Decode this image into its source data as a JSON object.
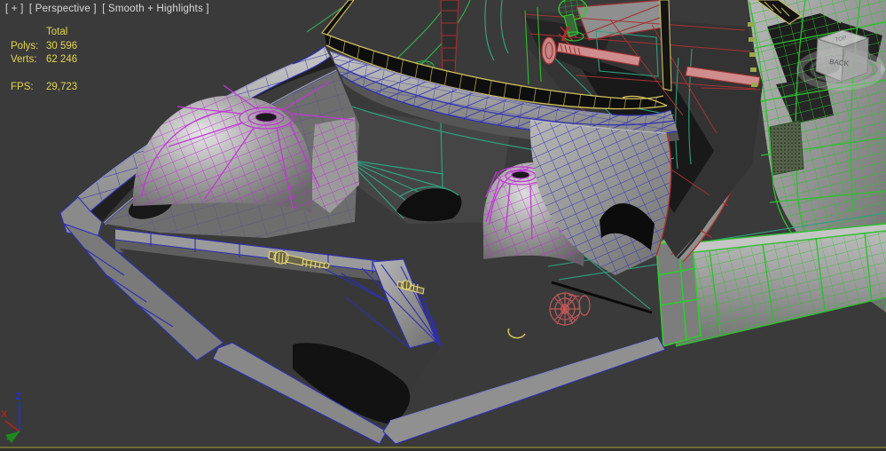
{
  "viewport": {
    "hud_menus": {
      "general_label": "[ + ]",
      "pov_label": "[ Perspective ]",
      "shading_label": "[ Smooth + Highlights ]"
    }
  },
  "stats": {
    "header": "Total",
    "rows": [
      {
        "label": "Polys:",
        "value": "30 596"
      },
      {
        "label": "Verts:",
        "value": "62 246"
      }
    ],
    "fps_label": "FPS:",
    "fps_value": "29,723"
  },
  "viewcube": {
    "front_face": "BACK",
    "top_face": "TOP"
  },
  "axis_gizmo": {
    "x_label": "X",
    "z_label": "Z"
  },
  "colors": {
    "viewport_bg": "#3a3a3a",
    "hud_text": "#d9d9d9",
    "stats_text": "#e5d54e",
    "wire_blue": "#2e2eb4",
    "wire_magenta": "#bb2fd0",
    "wire_teal": "#2fa080",
    "wire_green": "#2fbf2f",
    "wire_red": "#a83232",
    "wire_khaki": "#d2c25e",
    "beam_salmon": "#cf8d8d",
    "bottom_border": "#6d6d31"
  }
}
